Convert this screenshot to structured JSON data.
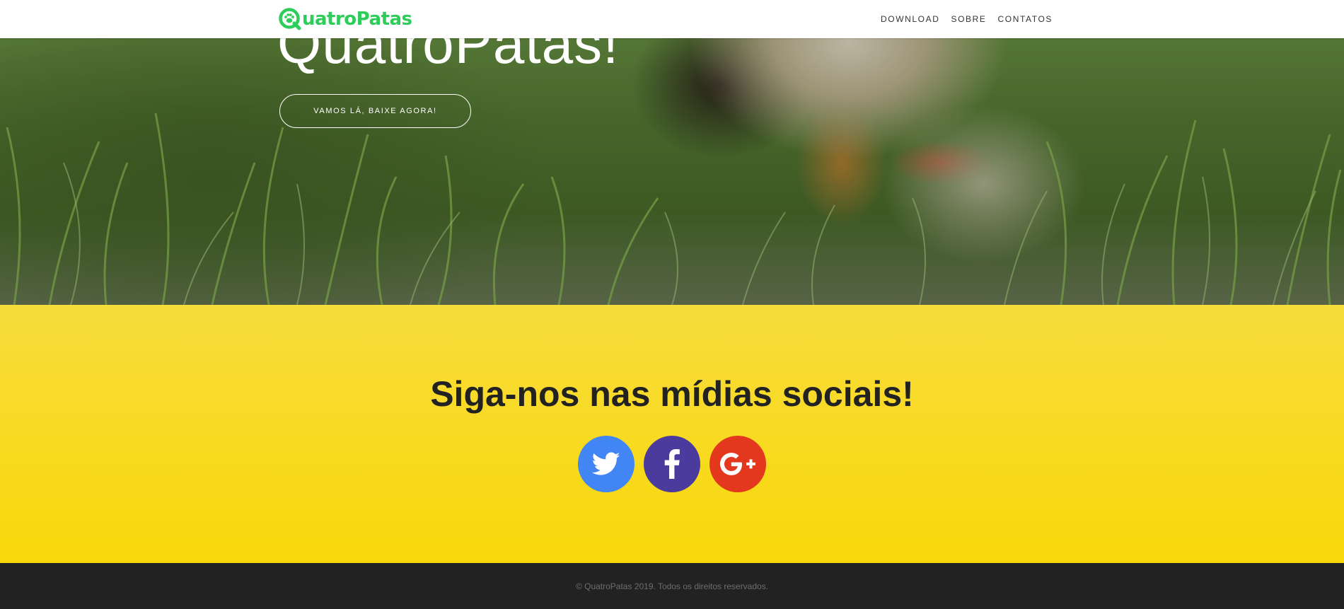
{
  "navbar": {
    "brand_text": "uatroPatas",
    "links": [
      {
        "label": "DOWNLOAD"
      },
      {
        "label": "SOBRE"
      },
      {
        "label": "CONTATOS"
      }
    ]
  },
  "hero": {
    "title": "QuatroPatas!",
    "button_label": "VAMOS LÁ, BAIXE AGORA!"
  },
  "social": {
    "title": "Siga-nos nas mídias sociais!",
    "icons": [
      {
        "name": "twitter-icon",
        "color": "#4285f4"
      },
      {
        "name": "facebook-icon",
        "color": "#4a3b9c"
      },
      {
        "name": "google-plus-icon",
        "color": "#e3371e"
      }
    ]
  },
  "footer": {
    "copyright": "© QuatroPatas 2019. Todos os direitos reservados."
  },
  "colors": {
    "brand_green": "#2ecc5a",
    "social_yellow": "#f8d80a",
    "footer_dark": "#222222"
  }
}
